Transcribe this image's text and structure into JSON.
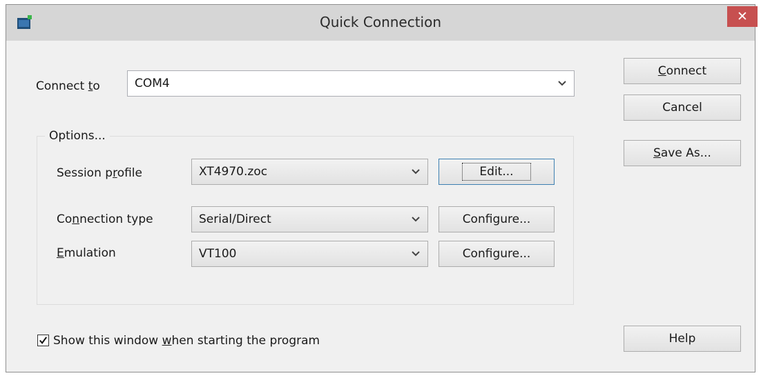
{
  "window": {
    "title": "Quick Connection",
    "close_glyph": "✕",
    "app_icon": "terminal-app-icon"
  },
  "connect_to": {
    "label_pre": "Connect ",
    "label_accel": "t",
    "label_post": "o",
    "value": "COM4"
  },
  "options": {
    "group_label": "Options...",
    "session_profile": {
      "label_pre": "Session p",
      "label_accel": "r",
      "label_post": "ofile",
      "value": "XT4970.zoc",
      "button": "Edit..."
    },
    "connection_type": {
      "label_pre": "Co",
      "label_accel": "n",
      "label_post": "nection type",
      "value": "Serial/Direct",
      "button": "Configure..."
    },
    "emulation": {
      "label_pre": "",
      "label_accel": "E",
      "label_post": "mulation",
      "value": "VT100",
      "button": "Configure..."
    }
  },
  "buttons": {
    "connect_accel": "C",
    "connect_rest": "onnect",
    "cancel": "Cancel",
    "save_accel": "S",
    "save_rest": "ave As...",
    "help": "Help"
  },
  "show_window": {
    "checked": true,
    "label_pre": "Show this window ",
    "label_accel": "w",
    "label_post": "hen starting the program"
  },
  "colors": {
    "titlebar": "#d6d6d6",
    "close": "#c75050",
    "dialog_bg": "#f0f0f0",
    "focus_border": "#3c7fb1"
  }
}
